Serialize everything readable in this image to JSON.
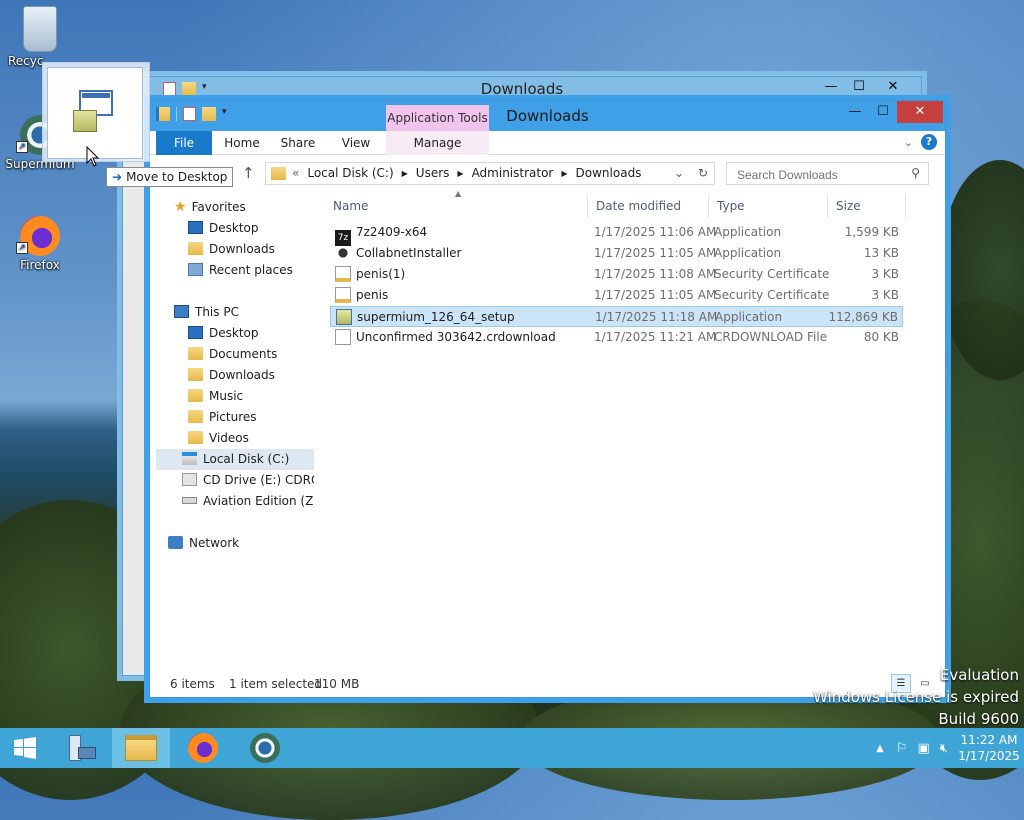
{
  "desktop": {
    "icons": [
      {
        "label": "Recyc",
        "icon": "recycle-bin-icon"
      },
      {
        "label": "Supermium",
        "icon": "supermium-icon"
      },
      {
        "label": "Firefox",
        "icon": "firefox-icon"
      }
    ],
    "drag_tooltip": "Move to Desktop",
    "watermark": [
      "Evaluation",
      "Windows License is expired",
      "Build 9600"
    ],
    "back_window_title": "Downloads"
  },
  "window": {
    "title": "Downloads",
    "contextual_tab": "Application Tools",
    "tabs": [
      {
        "label": "File"
      },
      {
        "label": "Home"
      },
      {
        "label": "Share"
      },
      {
        "label": "View"
      },
      {
        "label": "Manage"
      }
    ],
    "help_label": "?",
    "address": {
      "prefix": "«",
      "crumbs": [
        "Local Disk (C:)",
        "Users",
        "Administrator",
        "Downloads"
      ]
    },
    "search": {
      "placeholder": "Search Downloads",
      "value": ""
    },
    "nav": {
      "favorites_label": "Favorites",
      "favorites": [
        "Desktop",
        "Downloads",
        "Recent places"
      ],
      "thispc_label": "This PC",
      "thispc": [
        "Desktop",
        "Documents",
        "Downloads",
        "Music",
        "Pictures",
        "Videos",
        "Local Disk (C:)",
        "CD Drive (E:) CDROM",
        "Aviation Edition (Z:)"
      ],
      "network_label": "Network",
      "selected": "Local Disk (C:)"
    },
    "columns": {
      "name": "Name",
      "date": "Date modified",
      "type": "Type",
      "size": "Size"
    },
    "files": [
      {
        "name": "7z2409-x64",
        "date": "1/17/2025 11:06 AM",
        "type": "Application",
        "size": "1,599 KB",
        "icon": "7zip-icon",
        "selected": false
      },
      {
        "name": "CollabnetInstaller",
        "date": "1/17/2025 11:05 AM",
        "type": "Application",
        "size": "13 KB",
        "icon": "installer-icon",
        "selected": false
      },
      {
        "name": "penis(1)",
        "date": "1/17/2025 11:08 AM",
        "type": "Security Certificate",
        "size": "3 KB",
        "icon": "certificate-icon",
        "selected": false
      },
      {
        "name": "penis",
        "date": "1/17/2025 11:05 AM",
        "type": "Security Certificate",
        "size": "3 KB",
        "icon": "certificate-icon",
        "selected": false
      },
      {
        "name": "supermium_126_64_setup",
        "date": "1/17/2025 11:18 AM",
        "type": "Application",
        "size": "112,869 KB",
        "icon": "setup-icon",
        "selected": true
      },
      {
        "name": "Unconfirmed 303642.crdownload",
        "date": "1/17/2025 11:21 AM",
        "type": "CRDOWNLOAD File",
        "size": "80 KB",
        "icon": "blank-file-icon",
        "selected": false
      }
    ],
    "status": {
      "items": "6 items",
      "selected": "1 item selected",
      "size": "110 MB"
    }
  },
  "taskbar": {
    "items": [
      "start-icon",
      "server-manager-icon",
      "file-explorer-icon",
      "firefox-icon",
      "supermium-icon"
    ],
    "clock_time": "11:22 AM",
    "clock_date": "1/17/2025"
  },
  "colors": {
    "accent": "#3fa0e8",
    "file_tab": "#1979ca",
    "contextual_tab": "#f0c4ec",
    "selection": "#cce4f7",
    "taskbar": "#3fa4d6"
  }
}
